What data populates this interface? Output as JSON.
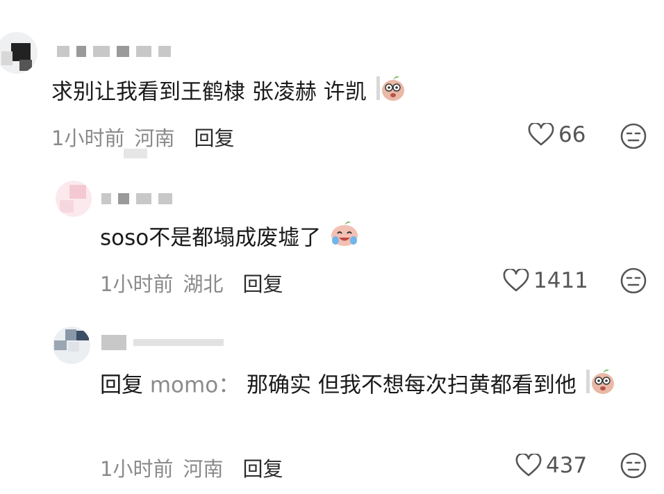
{
  "comments": [
    {
      "text": "求别让我看到王鹤棣 张凌赫 许凯",
      "time": "1小时前",
      "location": "河南",
      "reply_label": "回复",
      "likes": "66",
      "emoji_icon": "shy-peek-emoji-icon"
    },
    {
      "text": "soso不是都塌成废墟了",
      "time": "1小时前",
      "location": "湖北",
      "reply_label": "回复",
      "likes": "1411",
      "emoji_icon": "laugh-cry-emoji-icon"
    },
    {
      "reply_prefix": "回复",
      "reply_to": "momo：",
      "text": "那确实 但我不想每次扫黄都看到他",
      "time": "1小时前",
      "location": "河南",
      "reply_label": "回复",
      "likes": "437",
      "emoji_icon": "shy-peek-emoji-icon"
    }
  ],
  "colors": {
    "text": "#1a1a1a",
    "meta": "#8a8a8a",
    "icon": "#555555"
  }
}
